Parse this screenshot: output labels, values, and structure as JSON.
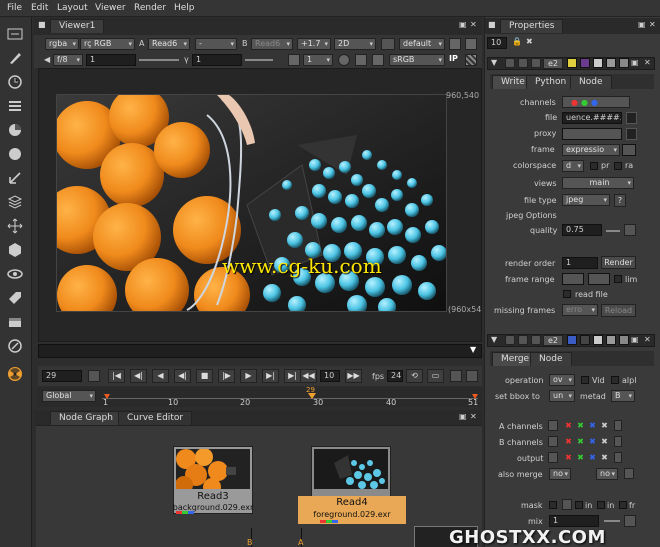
{
  "menu": [
    "File",
    "Edit",
    "Layout",
    "Viewer",
    "Render",
    "Help"
  ],
  "viewer": {
    "tab": "Viewer1",
    "channels": "rgba",
    "colorspace_in": "rç RGB",
    "a_label": "A",
    "a_input": "Read6",
    "a_op": "-",
    "b_label": "B",
    "b_input": "Read6",
    "gain": "+1.7",
    "view_mode": "2D",
    "overlay": "default",
    "fstop": "f/8",
    "gain_value": "1",
    "gamma_label": "γ",
    "gamma_value": "1",
    "proxy_value": "1",
    "lut": "sRGB",
    "ip_label": "IP",
    "format_top": "960,540",
    "format_bottom": "(960x54",
    "watermark": "www.cg-ku.com"
  },
  "transport": {
    "frame": "29",
    "step": "10",
    "fps_label": "fps",
    "fps": "24",
    "range_mode": "Global",
    "ticks": [
      "1",
      "10",
      "20",
      "30",
      "40",
      "51"
    ],
    "current": "29"
  },
  "nodegraph": {
    "tab1": "Node Graph",
    "tab2": "Curve Editor",
    "node1_name": "Read3",
    "node1_file": "background.029.exr",
    "node2_name": "Read4",
    "node2_file": "foreground.029.exr",
    "edge_b": "B",
    "edge_a": "A"
  },
  "properties": {
    "title": "Properties",
    "max_panels": "10",
    "write": {
      "node_label": "e2",
      "tabs": [
        "Write",
        "Python",
        "Node"
      ],
      "channels_label": "channels",
      "file_label": "file",
      "file_value": "uence.####.",
      "proxy_label": "proxy",
      "frame_label": "frame",
      "frame_value": "expressio",
      "colorspace_label": "colorspace",
      "colorspace_value": "d",
      "premult_label": "pr",
      "raw_label": "ra",
      "views_label": "views",
      "views_value": "main",
      "filetype_label": "file type",
      "filetype_value": "jpeg",
      "help_label": "?",
      "jpeg_options": "jpeg Options",
      "quality_label": "quality",
      "quality_value": "0.75",
      "render_order_label": "render order",
      "render_order_value": "1",
      "render_button": "Render",
      "frame_range_label": "frame range",
      "limit_label": "lim",
      "read_file_label": "read file",
      "missing_frames_label": "missing frames",
      "missing_frames_value": "erro",
      "reload_button": "Reload"
    },
    "merge": {
      "node_label": "e2",
      "tabs": [
        "Merge",
        "Node"
      ],
      "operation_label": "operation",
      "operation_value": "ov",
      "video_label": "Vid",
      "alpha_label": "alpl",
      "bbox_label": "set bbox to",
      "bbox_value": "un",
      "metadata_label": "metad",
      "metadata_value": "B",
      "a_channels_label": "A channels",
      "b_channels_label": "B channels",
      "output_label": "output",
      "also_merge_label": "also merge",
      "also_merge_value": "no",
      "also_merge_value2": "no",
      "mask_label": "mask",
      "in_label": "in",
      "in_label2": "in",
      "fr_label": "fr",
      "mix_label": "mix",
      "mix_value": "1"
    }
  },
  "brand": "GHOSTXX.COM",
  "colors": {
    "accent": "#f0a030",
    "node_orange": "#e8a855",
    "panel": "#3a3a3a",
    "watermark": "#ffe600"
  }
}
